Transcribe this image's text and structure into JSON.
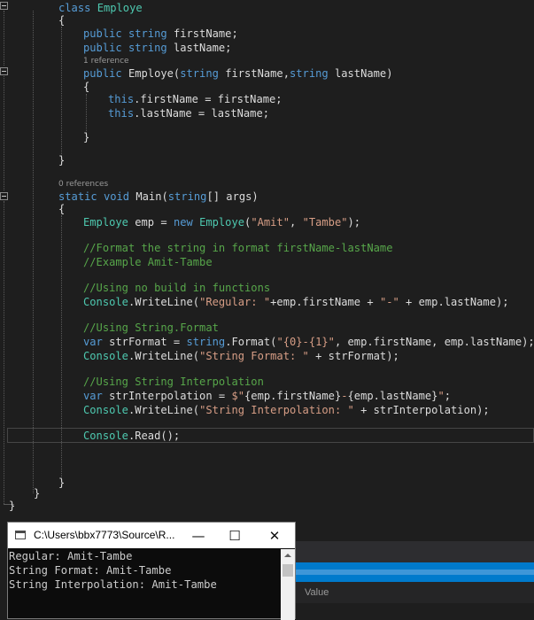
{
  "editor": {
    "codelens": {
      "ctor_refs": "1 reference",
      "main_refs": "0 references"
    },
    "code": {
      "class_decl": [
        "class",
        "Employe"
      ],
      "open_brace": "{",
      "close_brace": "}",
      "field_first": [
        "public",
        "string",
        "firstName;"
      ],
      "field_last": [
        "public",
        "string",
        "lastName;"
      ],
      "ctor": [
        "public",
        "Employe(",
        "string",
        "firstName,",
        "string",
        "lastName)"
      ],
      "assign_first": [
        "this",
        ".firstName = firstName;"
      ],
      "assign_last": [
        "this",
        ".lastName = lastName;"
      ],
      "main_decl": [
        "static",
        "void",
        "Main(",
        "string",
        "[] args)"
      ],
      "new_emp": [
        "Employe",
        "emp = ",
        "new",
        "Employe",
        "(",
        "\"Amit\"",
        ", ",
        "\"Tambe\"",
        ");"
      ],
      "comment1": "//Format the string in format firstName-lastName",
      "comment2": "//Example Amit-Tambe",
      "comment3": "//Using no build in functions",
      "writeline_regular": [
        "Console",
        ".WriteLine(",
        "\"Regular: \"",
        "+emp.firstName + ",
        "\"-\"",
        " + emp.lastName);"
      ],
      "comment4": "//Using String.Format",
      "strformat": [
        "var",
        "strFormat = ",
        "string",
        ".Format(",
        "\"{0}-{1}\"",
        ", emp.firstName, emp.lastName);"
      ],
      "writeline_format": [
        "Console",
        ".WriteLine(",
        "\"String Format: \"",
        " + strFormat);"
      ],
      "comment5": "//Using String Interpolation",
      "interp": [
        "var",
        "strInterpolation = ",
        "$\"",
        "{emp.firstName}",
        "-",
        "{emp.lastName}",
        "\"",
        ";"
      ],
      "writeline_interp": [
        "Console",
        ".WriteLine(",
        "\"String Interpolation: \"",
        " + strInterpolation);"
      ],
      "read": [
        "Console",
        ".Read();"
      ]
    }
  },
  "console_window": {
    "title": "C:\\Users\\bbx7773\\Source\\R...",
    "minimize": "—",
    "maximize": "☐",
    "close": "✕",
    "output": [
      "Regular: Amit-Tambe",
      "String Format: Amit-Tambe",
      "String Interpolation: Amit-Tambe"
    ]
  },
  "bottom_panel": {
    "value_header": "Value"
  },
  "colors": {
    "background": "#1e1e1e",
    "keyword": "#569cd6",
    "type": "#4ec9b0",
    "string": "#d69d85",
    "comment": "#57a64a",
    "accent": "#007acc"
  }
}
